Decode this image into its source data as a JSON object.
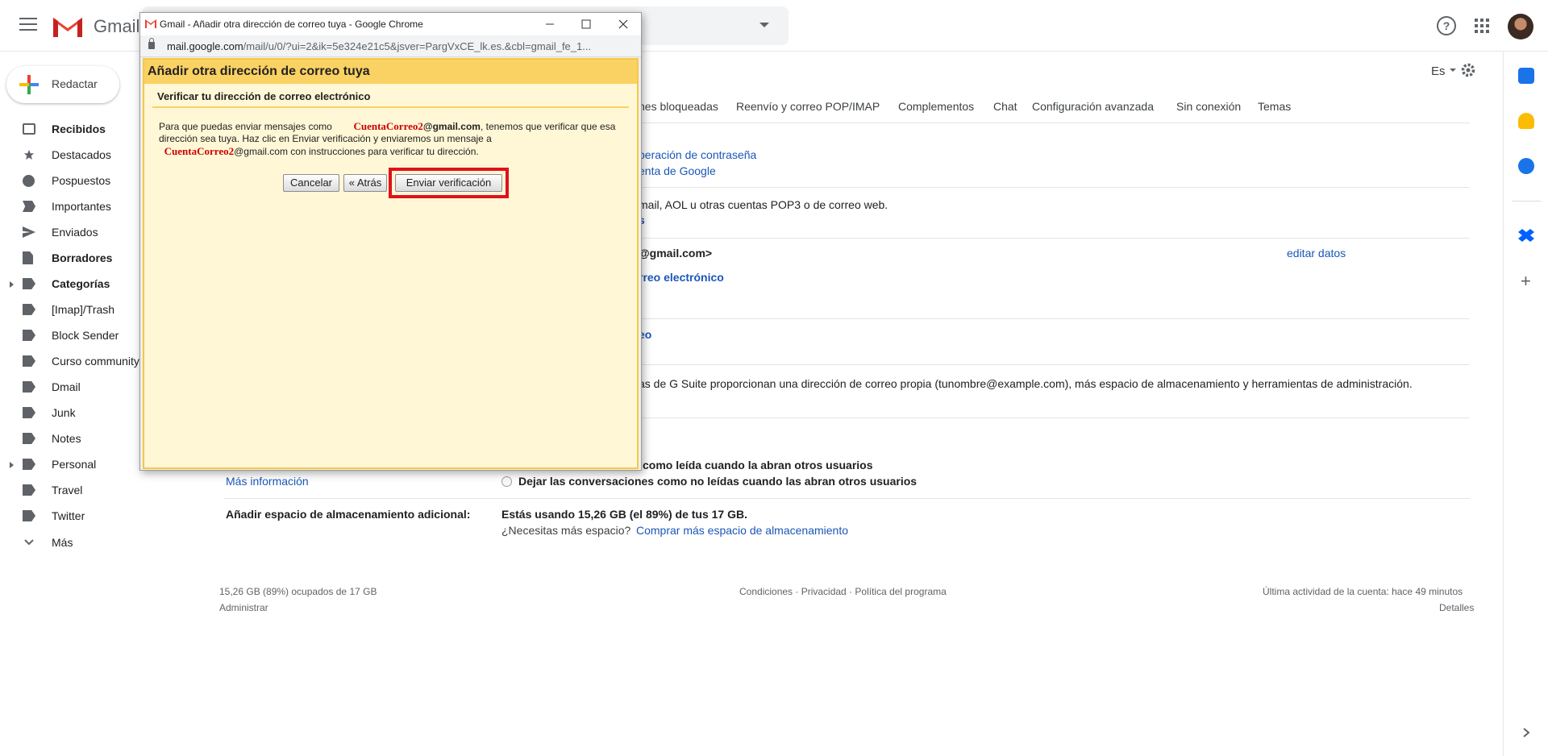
{
  "header": {
    "app_name": "Gmail",
    "lang_selector": "Es"
  },
  "compose": {
    "label": "Redactar"
  },
  "sidebar": {
    "items": [
      {
        "label": "Recibidos",
        "icon": "inbox-icon",
        "bold": true
      },
      {
        "label": "Destacados",
        "icon": "star-icon"
      },
      {
        "label": "Pospuestos",
        "icon": "clock-icon"
      },
      {
        "label": "Importantes",
        "icon": "important-icon"
      },
      {
        "label": "Enviados",
        "icon": "send-icon"
      },
      {
        "label": "Borradores",
        "icon": "draft-icon",
        "bold": true
      },
      {
        "label": "Categorías",
        "icon": "label-icon",
        "bold": true
      },
      {
        "label": "[Imap]/Trash",
        "icon": "label-icon"
      },
      {
        "label": "Block Sender",
        "icon": "label-icon"
      },
      {
        "label": "Curso community",
        "icon": "label-icon"
      },
      {
        "label": "Dmail",
        "icon": "label-icon"
      },
      {
        "label": "Junk",
        "icon": "label-icon"
      },
      {
        "label": "Notes",
        "icon": "label-icon"
      },
      {
        "label": "Personal",
        "icon": "label-icon"
      },
      {
        "label": "Travel",
        "icon": "label-icon"
      },
      {
        "label": "Twitter",
        "icon": "label-icon"
      },
      {
        "label": "Más",
        "icon": "chevron-down-icon"
      }
    ]
  },
  "settings": {
    "tabs": [
      "nes bloqueadas",
      "Reenvío y correo POP/IMAP",
      "Complementos",
      "Chat",
      "Configuración avanzada",
      "Sin conexión",
      "Temas"
    ],
    "lines": {
      "recovery": "peración de contraseña",
      "google_account": "enta de Google",
      "pop_text": "mail, AOL u otras cuentas POP3 o de correo web.",
      "pop_link": "s",
      "gmail_addr": "@gmail.com>",
      "edit_data": "editar datos",
      "email_link": "rreo electrónico",
      "eo_link": "eo",
      "gsuite_text": "as de G Suite proporcionan una dirección de correo propia (tunombre@example.com), más espacio de almacenamiento y herramientas de administración.",
      "read_option": "como leída cuando la abran otros usuarios",
      "unread_option": "Dejar las conversaciones como no leídas cuando las abran otros usuarios",
      "more_info": "Más información",
      "storage_label": "Añadir espacio de almacenamiento adicional:",
      "storage_usage": "Estás usando 15,26 GB (el 89%) de tus 17 GB.",
      "need_space": "¿Necesitas más espacio?",
      "buy_space": "Comprar más espacio de almacenamiento"
    }
  },
  "footer": {
    "storage": "15,26 GB (89%) ocupados de 17 GB",
    "admin": "Administrar",
    "terms": "Condiciones · Privacidad · Política del programa",
    "last_activity": "Última actividad de la cuenta: hace 49 minutos",
    "details": "Detalles"
  },
  "popup": {
    "window_title": "Gmail - Añadir otra dirección de correo tuya - Google Chrome",
    "url_host": "mail.google.com",
    "url_path": "/mail/u/0/?ui=2&ik=5e324e21c5&jsver=PargVxCE_lk.es.&cbl=gmail_fe_1...",
    "heading": "Añadir otra dirección de correo tuya",
    "subheading": "Verificar tu dirección de correo electrónico",
    "text_1": "Para que puedas enviar mensajes como",
    "account_name": "CuentaCorreo2",
    "domain": "@gmail.com",
    "text_2": ", tenemos que verificar que esa dirección sea tuya. Haz clic en Enviar verificación y enviaremos un mensaje a",
    "text_3": " con instrucciones para verificar tu dirección.",
    "buttons": {
      "cancel": "Cancelar",
      "back": "« Atrás",
      "send": "Enviar verificación"
    }
  },
  "colors": {
    "highlight": "#e0121b",
    "popup_header": "#fad163",
    "popup_bg": "#fff7d6",
    "link": "#1a57b8"
  }
}
